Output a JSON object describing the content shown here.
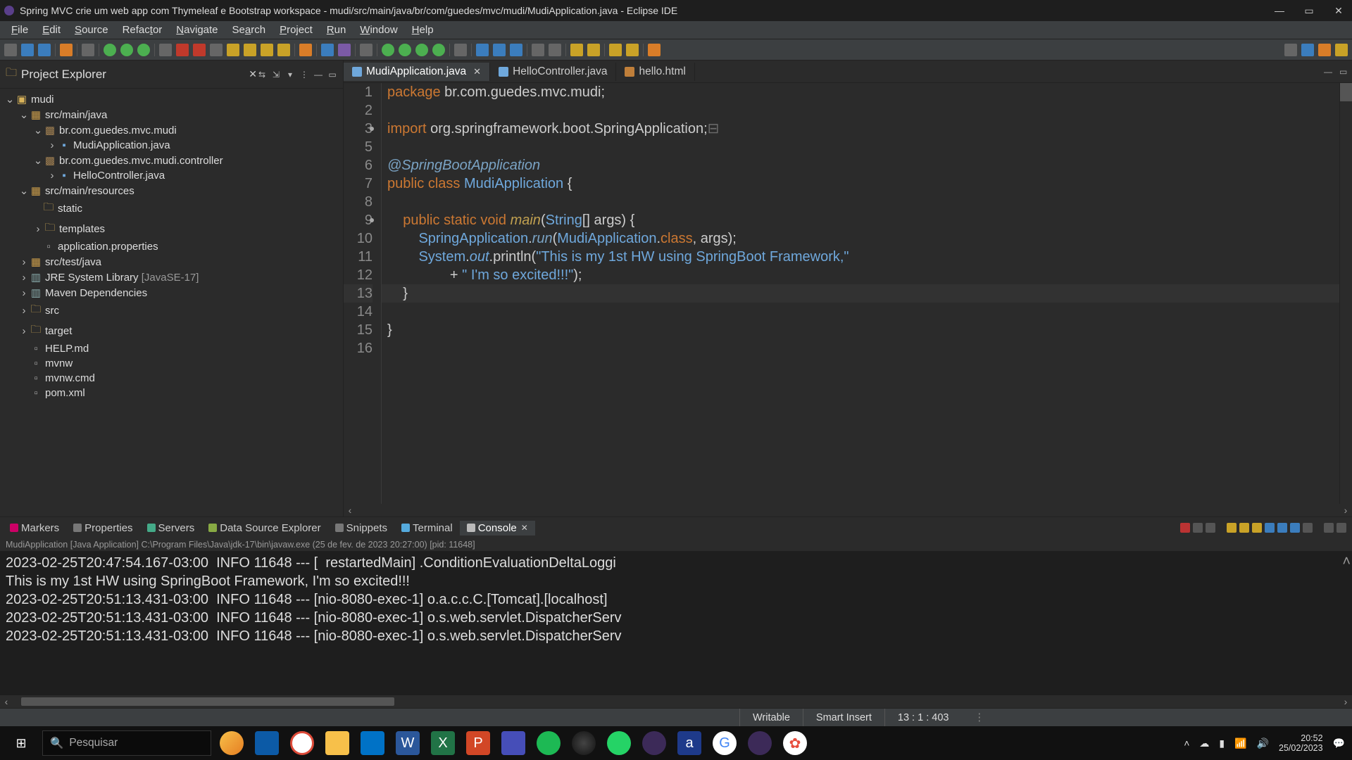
{
  "title": "Spring MVC crie um web app com Thymeleaf e Bootstrap workspace - mudi/src/main/java/br/com/guedes/mvc/mudi/MudiApplication.java - Eclipse IDE",
  "menu": [
    "File",
    "Edit",
    "Source",
    "Refactor",
    "Navigate",
    "Search",
    "Project",
    "Run",
    "Window",
    "Help"
  ],
  "explorer": {
    "title": "Project Explorer",
    "tree": {
      "root": "mudi",
      "srcmain": "src/main/java",
      "pkg1": "br.com.guedes.mvc.mudi",
      "cls1": "MudiApplication.java",
      "pkg2": "br.com.guedes.mvc.mudi.controller",
      "cls2": "HelloController.java",
      "res": "src/main/resources",
      "static": "static",
      "templates": "templates",
      "appprops": "application.properties",
      "srctest": "src/test/java",
      "jre": "JRE System Library",
      "jredeco": "[JavaSE-17]",
      "maven": "Maven Dependencies",
      "srcf": "src",
      "target": "target",
      "help": "HELP.md",
      "mvnw": "mvnw",
      "mvnwcmd": "mvnw.cmd",
      "pom": "pom.xml"
    }
  },
  "editor": {
    "tabs": [
      {
        "label": "MudiApplication.java",
        "active": true
      },
      {
        "label": "HelloController.java",
        "active": false
      },
      {
        "label": "hello.html",
        "active": false
      }
    ],
    "lines": [
      "1",
      "2",
      "3",
      "5",
      "6",
      "7",
      "8",
      "9",
      "10",
      "11",
      "12",
      "13",
      "14",
      "15",
      "16"
    ],
    "code": {
      "l1_kw": "package",
      "l1_rest": " br.com.guedes.mvc.mudi;",
      "l3_kw": "import",
      "l3_rest": " org.springframework.boot.SpringApplication;",
      "l6": "@SpringBootApplication",
      "l7_kw1": "public",
      "l7_kw2": "class",
      "l7_name": "MudiApplication",
      "l7_brace": " {",
      "l9_kw1": "public",
      "l9_kw2": "static",
      "l9_kw3": "void",
      "l9_main": "main",
      "l9_sig_open": "(",
      "l9_str": "String",
      "l9_sig_rest": "[] args) {",
      "l10_a": "SpringApplication",
      "l10_b": ".",
      "l10_run": "run",
      "l10_c": "(",
      "l10_cls": "MudiApplication",
      "l10_d": ".",
      "l10_class": "class",
      "l10_e": ", args);",
      "l11_a": "System",
      "l11_b": ".",
      "l11_out": "out",
      "l11_c": ".println(",
      "l11_str": "\"This is my 1st HW using SpringBoot Framework,\"",
      "l12_a": "+ ",
      "l12_str": "\" I'm so excited!!!\"",
      "l12_b": ");",
      "l13": "    }",
      "l15": "}"
    }
  },
  "bottom": {
    "tabs": [
      "Markers",
      "Properties",
      "Servers",
      "Data Source Explorer",
      "Snippets",
      "Terminal",
      "Console"
    ],
    "meta": "MudiApplication [Java Application] C:\\Program Files\\Java\\jdk-17\\bin\\javaw.exe  (25 de fev. de 2023 20:27:00) [pid: 11648]",
    "lines": [
      "2023-02-25T20:47:54.167-03:00  INFO 11648 --- [  restartedMain] .ConditionEvaluationDeltaLoggi",
      "This is my 1st HW using SpringBoot Framework, I'm so excited!!!",
      "2023-02-25T20:51:13.431-03:00  INFO 11648 --- [nio-8080-exec-1] o.a.c.c.C.[Tomcat].[localhost]",
      "2023-02-25T20:51:13.431-03:00  INFO 11648 --- [nio-8080-exec-1] o.s.web.servlet.DispatcherServ",
      "2023-02-25T20:51:13.431-03:00  INFO 11648 --- [nio-8080-exec-1] o.s.web.servlet.DispatcherServ"
    ]
  },
  "status": {
    "writable": "Writable",
    "insert": "Smart Insert",
    "pos": "13 : 1 : 403"
  },
  "taskbar": {
    "search_placeholder": "Pesquisar",
    "time": "20:52",
    "date": "25/02/2023"
  }
}
